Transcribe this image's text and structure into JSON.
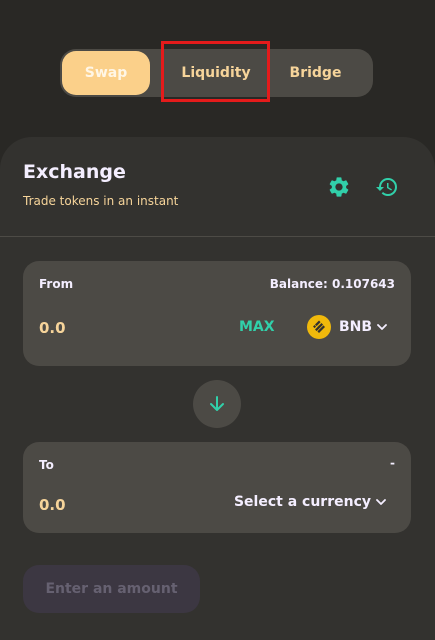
{
  "tabs": [
    {
      "label": "Swap",
      "active": true
    },
    {
      "label": "Liquidity",
      "active": false,
      "highlighted": true
    },
    {
      "label": "Bridge",
      "active": false
    }
  ],
  "exchange": {
    "title": "Exchange",
    "subtitle": "Trade tokens in an instant"
  },
  "from": {
    "label": "From",
    "balance": "Balance: 0.107643",
    "amount": "0.0",
    "max_label": "MAX",
    "token": "BNB"
  },
  "to": {
    "label": "To",
    "balance": "-",
    "amount": "0.0",
    "select_label": "Select a currency"
  },
  "submit_label": "Enter an amount",
  "colors": {
    "accent": "#31d0aa",
    "tab_active": "#fbd08a",
    "highlight": "#e41b1b",
    "bnb": "#f0b90b"
  },
  "icons": [
    "settings-icon",
    "history-icon",
    "bnb-icon",
    "chevron-down-icon",
    "arrow-down-icon"
  ]
}
